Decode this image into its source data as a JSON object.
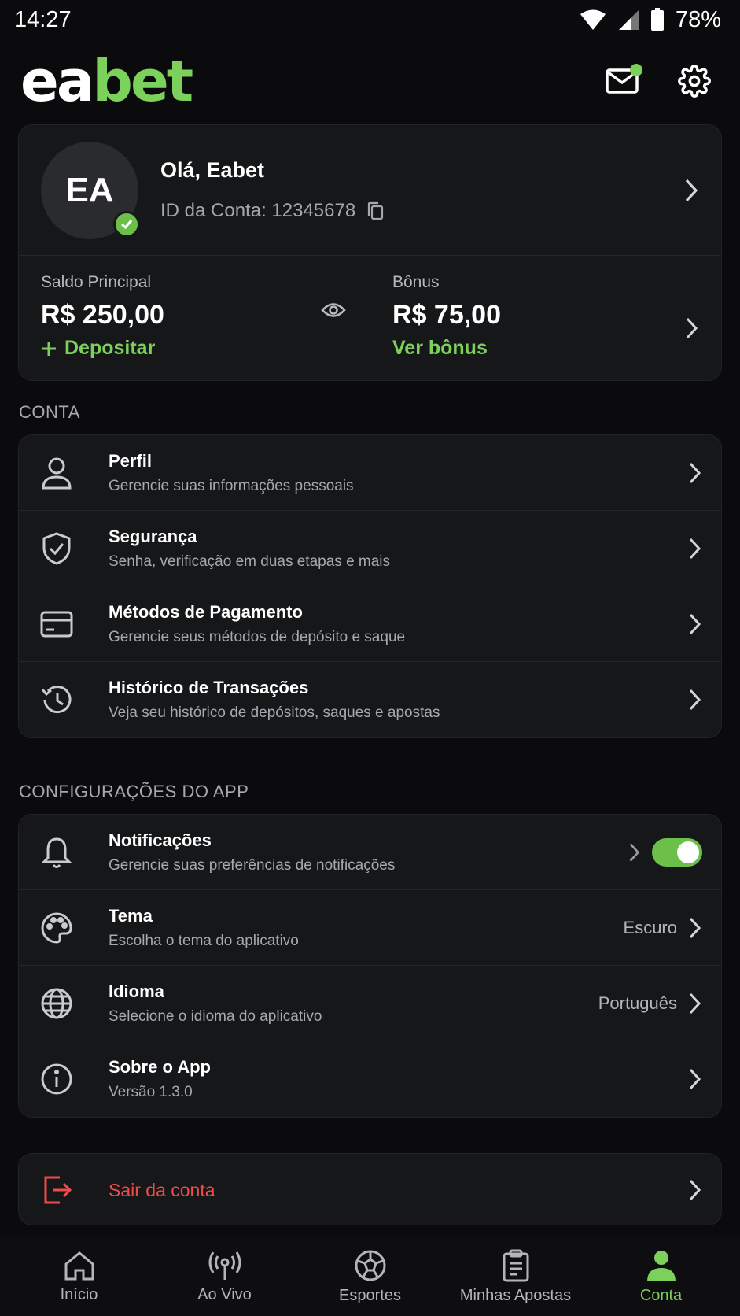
{
  "status_bar": {
    "time": "14:27",
    "battery": "78%"
  },
  "app": {
    "logo_part1": "ea",
    "logo_part2": "bet",
    "accent": "#7cd15b",
    "danger": "#ef4b4b"
  },
  "profile": {
    "initials": "EA",
    "greeting": "Olá, Eabet",
    "account_id": "ID da Conta: 12345678"
  },
  "balances": {
    "main_label": "Saldo Principal",
    "main_value": "R$ 250,00",
    "deposit_label": "Depositar",
    "bonus_label": "Bônus",
    "bonus_value": "R$ 75,00",
    "bonus_link": "Ver bônus"
  },
  "sections": {
    "account_title": "CONTA",
    "settings_title": "CONFIGURAÇÕES DO APP"
  },
  "account_items": [
    {
      "title": "Perfil",
      "subtitle": "Gerencie suas informações pessoais",
      "icon": "user-icon"
    },
    {
      "title": "Segurança",
      "subtitle": "Senha, verificação em duas etapas e mais",
      "icon": "shield-check-icon"
    },
    {
      "title": "Métodos de Pagamento",
      "subtitle": "Gerencie seus métodos de depósito e saque",
      "icon": "credit-card-icon"
    },
    {
      "title": "Histórico de Transações",
      "subtitle": "Veja seu histórico de depósitos, saques e apostas",
      "icon": "history-icon"
    }
  ],
  "settings_items": [
    {
      "title": "Notificações",
      "subtitle": "Gerencie suas preferências de notificações",
      "icon": "bell-icon",
      "toggle_on": true
    },
    {
      "title": "Tema",
      "subtitle": "Escolha o tema do aplicativo",
      "icon": "palette-icon",
      "value": "Escuro"
    },
    {
      "title": "Idioma",
      "subtitle": "Selecione o idioma do aplicativo",
      "icon": "globe-icon",
      "value": "Português"
    },
    {
      "title": "Sobre o App",
      "subtitle": "Versão 1.3.0",
      "icon": "info-icon"
    }
  ],
  "logout": {
    "label": "Sair da conta",
    "icon": "logout-icon"
  },
  "bottom_nav": [
    {
      "label": "Início",
      "icon": "home-icon"
    },
    {
      "label": "Ao Vivo",
      "icon": "live-broadcast-icon"
    },
    {
      "label": "Esportes",
      "icon": "soccer-ball-icon"
    },
    {
      "label": "Minhas Apostas",
      "icon": "clipboard-icon"
    },
    {
      "label": "Conta",
      "icon": "account-icon",
      "active": true
    }
  ]
}
